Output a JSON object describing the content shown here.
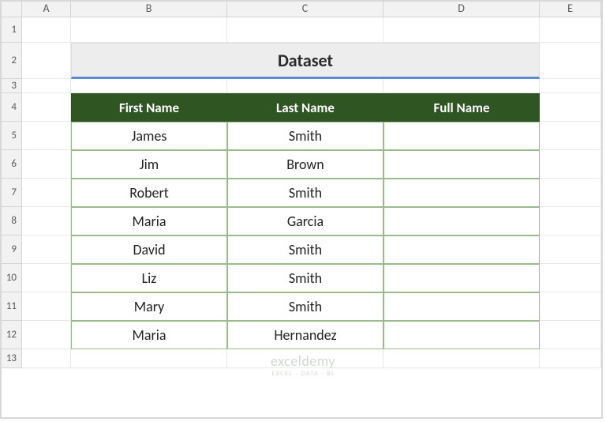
{
  "columns": [
    "A",
    "B",
    "C",
    "D",
    "E"
  ],
  "rows": [
    "1",
    "2",
    "3",
    "4",
    "5",
    "6",
    "7",
    "8",
    "9",
    "10",
    "11",
    "12",
    "13"
  ],
  "title": "Dataset",
  "headers": {
    "b": "First Name",
    "c": "Last Name",
    "d": "Full Name"
  },
  "data": [
    {
      "first": "James",
      "last": "Smith",
      "full": ""
    },
    {
      "first": "Jim",
      "last": "Brown",
      "full": ""
    },
    {
      "first": "Robert",
      "last": "Smith",
      "full": ""
    },
    {
      "first": "Maria",
      "last": "Garcia",
      "full": ""
    },
    {
      "first": "David",
      "last": "Smith",
      "full": ""
    },
    {
      "first": "Liz",
      "last": "Smith",
      "full": ""
    },
    {
      "first": "Mary",
      "last": "Smith",
      "full": ""
    },
    {
      "first": "Maria",
      "last": "Hernandez",
      "full": ""
    }
  ],
  "watermark": {
    "main": "exceldemy",
    "sub": "EXCEL · DATA · BI"
  }
}
